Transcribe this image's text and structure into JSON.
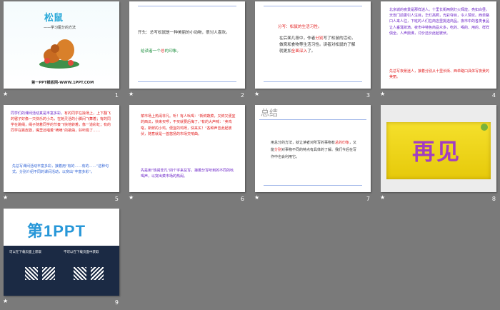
{
  "slides": [
    {
      "number": "1",
      "title": "松鼠",
      "subtitle": "——学习尾分的方法",
      "footer": "第一PPT模板网-WWW.1PPT.COM"
    },
    {
      "number": "2",
      "line1": "开头：总写松鼠是一种美丽的小动物，很讨人喜欢。",
      "line2a": "给读者一个",
      "line2b": "总",
      "line2c": "的印象。"
    },
    {
      "number": "3",
      "head": "分写：松鼠的生活习性。",
      "body_a": "在后面几段中，作者",
      "body_b": "分别",
      "body_c": "写了松鼠的活动，做窝和食物等生活习性。读者对松鼠的了解就更加",
      "body_d": "全面深入",
      "body_e": "了。"
    },
    {
      "number": "4",
      "body": "北京城的夜景是那样迷人。十里长街两侧灯火辉煌，亮如白昼。天安门前更引人注目，华灯高照，光彩夺目，令人赞叹。西单路口人来人往，下班的人们在商店里挑选商品。夜市中的各类食品让人垂涎欲滴。夜市中特色商品众多，吃的、喝的、用的、样样俱全。人声鼎沸，讨价还价此起彼伏。",
      "summary": "先总写夜景迷人，接着分别从十里长街、西单路口具体写夜景的美丽。"
    },
    {
      "number": "5",
      "body_a": "同学们的课间活动真是丰富多彩。",
      "body_b": "有的同学在操场上，上下翻飞的毽子好像一只快乐的小鸟，在她灵活的小脚间飞舞着；有的同学在跳绳，绳子随着同学的节奏飞快地转着，像一道彩虹；有的同学在跳皮筋，嘴里还唱着“嘀嘀”的歌曲，好听极了……",
      "summary": "先总写课间活动丰富多彩，接着用“有的……有的……”这种句式，分别介绍不同的课间活动，以突出“丰富多彩”。"
    },
    {
      "number": "6",
      "body_a": "菜市场上热闹非凡。听！有人吆喝：“新鲜蔬菜，又鲜又便宜的西瓜，快来买啰，不买就要后悔了。”有的大声喊：“卖鸡咯，新鲜的小鸡，便宜的鸡呀，快来买！”各种声音此起彼伏，随意就是一首悠扬的市场交响曲。",
      "summary": "先是用“热闹非凡”四个字来总写，接着分写听到的不同的吆喝声，以突出菜市场的热闹。"
    },
    {
      "number": "7",
      "title": "总结",
      "body_a": "用总分的方法，就让读者对所写的事物有",
      "body_b": "总的印象",
      "body_c": "，又能",
      "body_d": "分别",
      "body_e": "对事物不同的特点有具体的了解。我们今后在写作中也会利用它。"
    },
    {
      "number": "8",
      "word": "再见"
    },
    {
      "number": "9",
      "logo": "第1PPT",
      "caption_left": "可以在下载页面上获取",
      "caption_right": "不可以在下载页面中获取"
    }
  ],
  "colors": {
    "accent": "#e21f1f",
    "purple": "#6a21c7",
    "blue": "#2e62d6",
    "green": "#1e8f3f",
    "bg": "#7a7a7a"
  }
}
